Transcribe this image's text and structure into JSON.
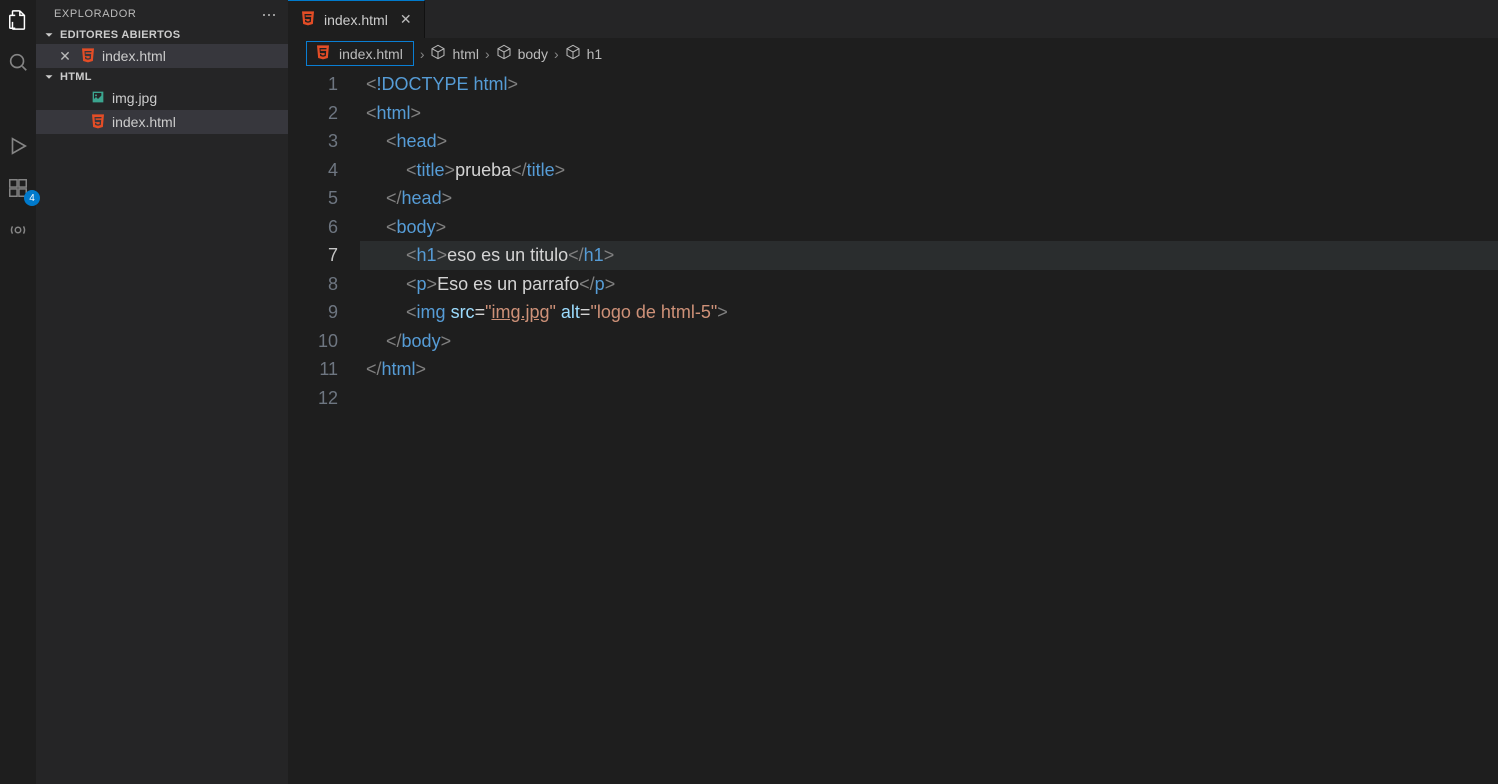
{
  "sidebar": {
    "title": "EXPLORADOR",
    "open_editors_title": "EDITORES ABIERTOS",
    "folder_title": "HTML",
    "open_editors": [
      {
        "name": "index.html",
        "icon": "html"
      }
    ],
    "files": [
      {
        "name": "img.jpg",
        "icon": "image"
      },
      {
        "name": "index.html",
        "icon": "html"
      }
    ]
  },
  "activity": {
    "badge": "4"
  },
  "tab": {
    "name": "index.html"
  },
  "breadcrumbs": {
    "items": [
      {
        "label": "index.html",
        "icon": "html"
      },
      {
        "label": "html",
        "icon": "cube"
      },
      {
        "label": "body",
        "icon": "cube"
      },
      {
        "label": "h1",
        "icon": "cube"
      }
    ]
  },
  "code": {
    "line_numbers": [
      "1",
      "2",
      "3",
      "4",
      "5",
      "6",
      "7",
      "8",
      "9",
      "10",
      "11",
      "12"
    ],
    "current_line_index": 6,
    "lines": [
      [
        {
          "t": "<",
          "c": "br"
        },
        {
          "t": "!DOCTYPE",
          "c": "doctype"
        },
        {
          "t": " html",
          "c": "doctype"
        },
        {
          "t": ">",
          "c": "br"
        }
      ],
      [
        {
          "t": "<",
          "c": "br"
        },
        {
          "t": "html",
          "c": "tag"
        },
        {
          "t": ">",
          "c": "br"
        }
      ],
      [
        {
          "t": "    ",
          "c": ""
        },
        {
          "t": "<",
          "c": "br"
        },
        {
          "t": "head",
          "c": "tag"
        },
        {
          "t": ">",
          "c": "br"
        }
      ],
      [
        {
          "t": "        ",
          "c": ""
        },
        {
          "t": "<",
          "c": "br"
        },
        {
          "t": "title",
          "c": "tag"
        },
        {
          "t": ">",
          "c": "br"
        },
        {
          "t": "prueba",
          "c": "text"
        },
        {
          "t": "</",
          "c": "br"
        },
        {
          "t": "title",
          "c": "tag"
        },
        {
          "t": ">",
          "c": "br"
        }
      ],
      [
        {
          "t": "    ",
          "c": ""
        },
        {
          "t": "</",
          "c": "br"
        },
        {
          "t": "head",
          "c": "tag"
        },
        {
          "t": ">",
          "c": "br"
        }
      ],
      [
        {
          "t": "    ",
          "c": ""
        },
        {
          "t": "<",
          "c": "br"
        },
        {
          "t": "body",
          "c": "tag"
        },
        {
          "t": ">",
          "c": "br"
        }
      ],
      [
        {
          "t": "        ",
          "c": ""
        },
        {
          "t": "<",
          "c": "br"
        },
        {
          "t": "h1",
          "c": "tag"
        },
        {
          "t": ">",
          "c": "br"
        },
        {
          "t": "eso es un titulo",
          "c": "text"
        },
        {
          "t": "</",
          "c": "br"
        },
        {
          "t": "h1",
          "c": "tag"
        },
        {
          "t": ">",
          "c": "br"
        }
      ],
      [
        {
          "t": "        ",
          "c": ""
        },
        {
          "t": "<",
          "c": "br"
        },
        {
          "t": "p",
          "c": "tag"
        },
        {
          "t": ">",
          "c": "br"
        },
        {
          "t": "Eso es un parrafo",
          "c": "text"
        },
        {
          "t": "</",
          "c": "br"
        },
        {
          "t": "p",
          "c": "tag"
        },
        {
          "t": ">",
          "c": "br"
        }
      ],
      [
        {
          "t": "        ",
          "c": ""
        },
        {
          "t": "<",
          "c": "br"
        },
        {
          "t": "img",
          "c": "tag"
        },
        {
          "t": " ",
          "c": ""
        },
        {
          "t": "src",
          "c": "attr"
        },
        {
          "t": "=",
          "c": "text"
        },
        {
          "t": "\"",
          "c": "str"
        },
        {
          "t": "img.jpg",
          "c": "str ul"
        },
        {
          "t": "\"",
          "c": "str"
        },
        {
          "t": " ",
          "c": ""
        },
        {
          "t": "alt",
          "c": "attr"
        },
        {
          "t": "=",
          "c": "text"
        },
        {
          "t": "\"logo de html-5\"",
          "c": "str"
        },
        {
          "t": ">",
          "c": "br"
        }
      ],
      [
        {
          "t": "    ",
          "c": ""
        },
        {
          "t": "</",
          "c": "br"
        },
        {
          "t": "body",
          "c": "tag"
        },
        {
          "t": ">",
          "c": "br"
        }
      ],
      [
        {
          "t": "</",
          "c": "br"
        },
        {
          "t": "html",
          "c": "tag"
        },
        {
          "t": ">",
          "c": "br"
        }
      ],
      []
    ]
  }
}
